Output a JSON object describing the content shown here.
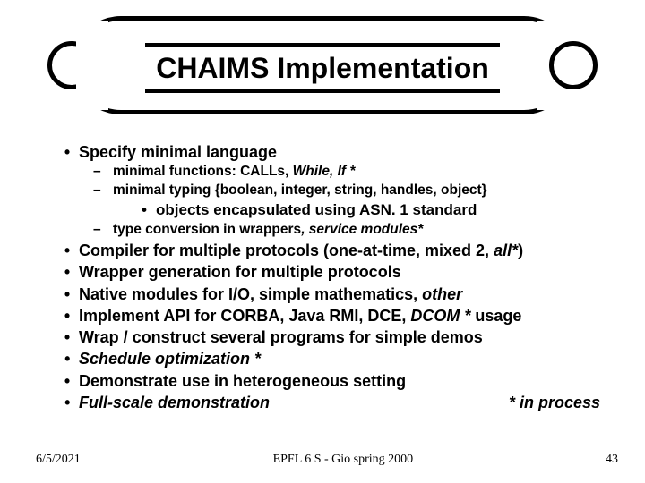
{
  "title": "CHAIMS Implementation",
  "b1": "Specify minimal language",
  "b1a_pre": "minimal functions: CALLs, ",
  "b1a_it": "While, If *",
  "b1b": "minimal typing {boolean, integer, string, handles, object}",
  "b1c": "objects encapsulated using ASN. 1 standard",
  "b1d_pre": "type conversion in wrappers",
  "b1d_it": ", service modules*",
  "b2_pre": "Compiler for multiple protocols (one-at-time, mixed 2, ",
  "b2_it": "all*",
  "b2_post": ")",
  "b3": "Wrapper generation for multiple protocols",
  "b4_pre": "Native modules for I/O, simple mathematics, ",
  "b4_it": "other",
  "b5_pre": "Implement API for CORBA, Java RMI, DCE, ",
  "b5_it": "DCOM *",
  "b5_post": " usage",
  "b6": "Wrap / construct several programs for simple demos",
  "b7": "Schedule optimization *",
  "b8": "Demonstrate use in heterogeneous setting",
  "b9": "Full-scale demonstration",
  "b9_note": "* in process",
  "footer_left": "6/5/2021",
  "footer_mid": "EPFL 6 S -  Gio spring 2000",
  "footer_right": "43"
}
